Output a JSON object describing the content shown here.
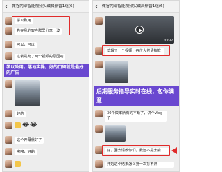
{
  "colors": {
    "chat_background": "#ededed",
    "sent_bubble": "#9eea6a",
    "received_bubble": "#ffffff",
    "highlight_red": "#e02b2b",
    "banner_purple": "#6a48d0"
  },
  "left_panel": {
    "header": {
      "title": "微谷内部智能视频实战启航营1组(6)",
      "back_icon": "chevron-left-icon",
      "more_icon": "more-icon"
    },
    "messages": {
      "m1": "学以致用",
      "m2": "先在我的客户群里分享一波",
      "m3": "可以，可以",
      "m4": "这就是为了两个视频的原因吧",
      "m5": "好的",
      "m6": "这个开幕就好了",
      "m7": "嘟嘟，好的"
    },
    "banner": "学以致用，落地实操，好的口碑就是最好的广告",
    "stickers": [
      "thumbs-up-sticker",
      "laughing-face-sticker",
      "laughing-face-sticker"
    ]
  },
  "right_panel": {
    "header": {
      "title": "微谷内部智能视频实战启航营1组(6)",
      "back_icon": "chevron-left-icon",
      "more_icon": "more-icon"
    },
    "messages": {
      "m1": "剪辑了一个视频，各位大佬请指教",
      "m2": "30个效率所有的不断了，讲个Vlog了",
      "m3": "好，回去请教你们，我还不是太会",
      "m4": "开始这个结果怎么第一次打不开"
    },
    "video": {
      "duration": "00:32"
    },
    "banner": "后期服务指导实时在线，包你满意"
  }
}
